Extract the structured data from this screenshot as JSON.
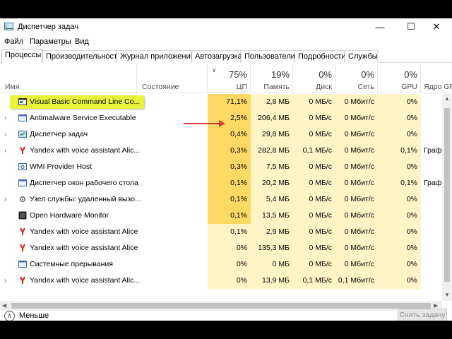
{
  "window": {
    "title": "Диспетчер задач",
    "minimize": "—",
    "maximize": "☐",
    "close": "✕"
  },
  "menu": [
    "Файл",
    "Параметры",
    "Вид"
  ],
  "tabs": [
    "Процессы",
    "Производительность",
    "Журнал приложений",
    "Автозагрузка",
    "Пользователи",
    "Подробности",
    "Службы"
  ],
  "columns": {
    "name": "Имя",
    "status": "Состояние",
    "cpu": {
      "pct": "75%",
      "label": "ЦП"
    },
    "memory": {
      "pct": "19%",
      "label": "Память"
    },
    "disk": {
      "pct": "0%",
      "label": "Диск"
    },
    "network": {
      "pct": "0%",
      "label": "Сеть"
    },
    "gpu": {
      "pct": "0%",
      "label": "GPU"
    },
    "gpu_engine": {
      "label": "Ядро GPU"
    }
  },
  "rows": [
    {
      "name": "Visual Basic Command Line Co...",
      "icon": "vb-window-icon",
      "expander": "",
      "cpu": "71,1%",
      "mem": "2,8 МБ",
      "disk": "0 МБ/с",
      "net": "0 Мбит/с",
      "gpu": "0%",
      "engine": ""
    },
    {
      "name": "Antimalware Service Executable",
      "icon": "window-icon",
      "expander": "›",
      "cpu": "2,5%",
      "mem": "206,4 МБ",
      "disk": "0 МБ/с",
      "net": "0 Мбит/с",
      "gpu": "0%",
      "engine": ""
    },
    {
      "name": "Диспетчер задач",
      "icon": "taskmgr-icon",
      "expander": "›",
      "cpu": "0,4%",
      "mem": "29,8 МБ",
      "disk": "0 МБ/с",
      "net": "0 Мбит/с",
      "gpu": "0%",
      "engine": ""
    },
    {
      "name": "Yandex with voice assistant Alic...",
      "icon": "yandex-icon",
      "expander": "›",
      "cpu": "0,3%",
      "mem": "282,8 МБ",
      "disk": "0,1 МБ/с",
      "net": "0 Мбит/с",
      "gpu": "0,1%",
      "engine": "Граф"
    },
    {
      "name": "WMI Provider Host",
      "icon": "gear-window-icon",
      "expander": "",
      "cpu": "0,3%",
      "mem": "7,5 МБ",
      "disk": "0 МБ/с",
      "net": "0 Мбит/с",
      "gpu": "0%",
      "engine": ""
    },
    {
      "name": "Диспетчер окон рабочего стола",
      "icon": "window-icon",
      "expander": "",
      "cpu": "0,1%",
      "mem": "20,2 МБ",
      "disk": "0 МБ/с",
      "net": "0 Мбит/с",
      "gpu": "0,1%",
      "engine": "Граф"
    },
    {
      "name": "Узел службы: удаленный вызо...",
      "icon": "gear-icon",
      "expander": "›",
      "cpu": "0,1%",
      "mem": "5,4 МБ",
      "disk": "0 МБ/с",
      "net": "0 Мбит/с",
      "gpu": "0%",
      "engine": ""
    },
    {
      "name": "Open Hardware Monitor",
      "icon": "ohm-icon",
      "expander": "",
      "cpu": "0,1%",
      "mem": "13,5 МБ",
      "disk": "0 МБ/с",
      "net": "0 Мбит/с",
      "gpu": "0%",
      "engine": ""
    },
    {
      "name": "Yandex with voice assistant Alice",
      "icon": "yandex-icon",
      "expander": "",
      "cpu": "0,1%",
      "mem": "2,9 МБ",
      "disk": "0 МБ/с",
      "net": "0 Мбит/с",
      "gpu": "0%",
      "engine": ""
    },
    {
      "name": "Yandex with voice assistant Alice",
      "icon": "yandex-icon",
      "expander": "",
      "cpu": "0%",
      "mem": "135,3 МБ",
      "disk": "0 МБ/с",
      "net": "0 Мбит/с",
      "gpu": "0%",
      "engine": ""
    },
    {
      "name": "Системные прерывания",
      "icon": "window-icon",
      "expander": "",
      "cpu": "0%",
      "mem": "0 МБ",
      "disk": "0 МБ/с",
      "net": "0 Мбит/с",
      "gpu": "0%",
      "engine": ""
    },
    {
      "name": "Yandex with voice assistant Alic...",
      "icon": "yandex-icon",
      "expander": "›",
      "cpu": "0%",
      "mem": "13,9 МБ",
      "disk": "0,1 МБ/с",
      "net": "0,1 Мбит/с",
      "gpu": "0%",
      "engine": ""
    }
  ],
  "footer": {
    "fewer": "Меньше",
    "fewer_icon": "chevron-up-icon",
    "end_task": "Снять задачу"
  },
  "colors": {
    "highlight": "#e8f43a",
    "arrow": "#e53935",
    "cpu_hot": "#ffd966",
    "cell_light": "#fff4c4"
  }
}
